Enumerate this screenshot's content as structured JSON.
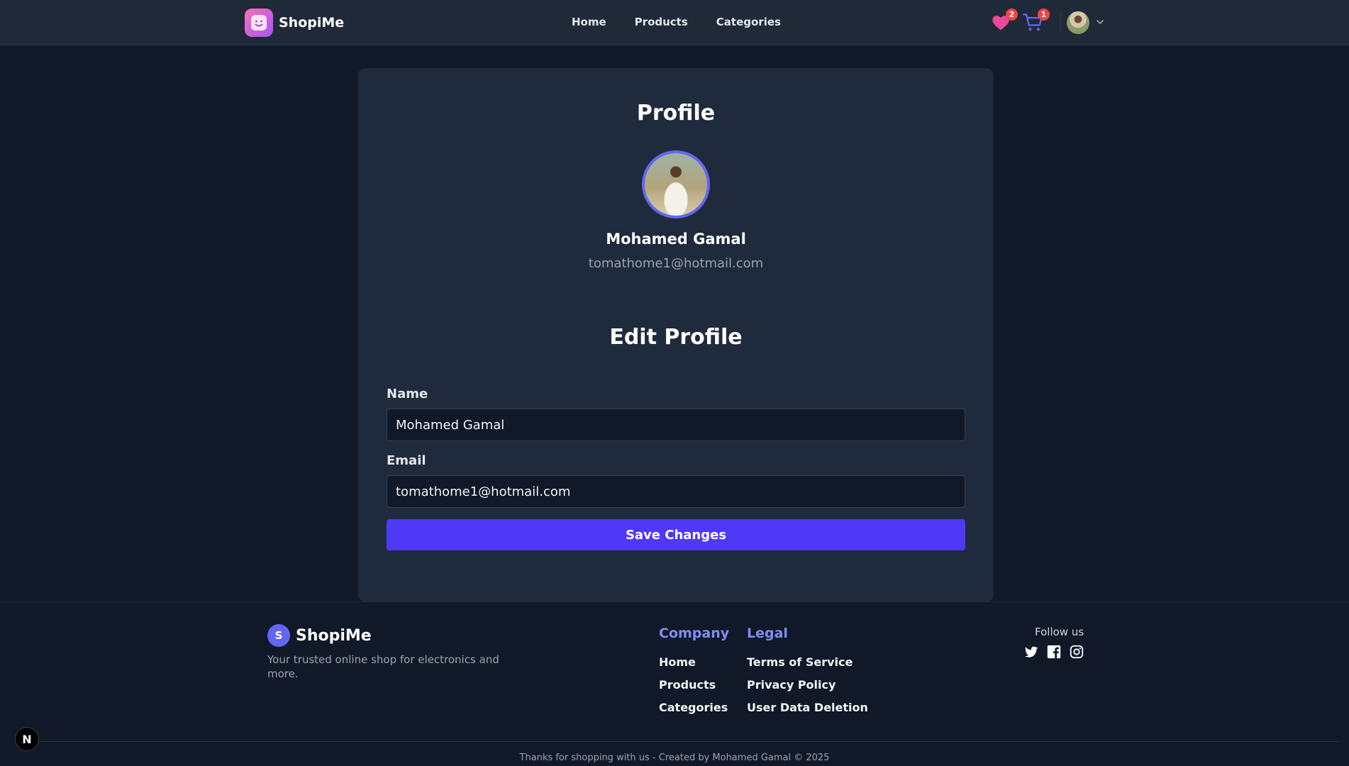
{
  "header": {
    "brand": "ShopiMe",
    "nav": [
      {
        "label": "Home"
      },
      {
        "label": "Products"
      },
      {
        "label": "Categories"
      }
    ],
    "wishlist_count": "2",
    "cart_count": "1",
    "icons": [
      "smile-logo-icon",
      "heart-icon",
      "cart-icon",
      "user-avatar",
      "chevron-down-icon"
    ]
  },
  "profile": {
    "title": "Profile",
    "name": "Mohamed Gamal",
    "email": "tomathome1@hotmail.com"
  },
  "edit": {
    "title": "Edit Profile",
    "name_label": "Name",
    "name_value": "Mohamed Gamal",
    "email_label": "Email",
    "email_value": "tomathome1@hotmail.com",
    "save_label": "Save Changes"
  },
  "footer": {
    "logo_letter": "S",
    "brand": "ShopiMe",
    "tagline": "Your trusted online shop for electronics and more.",
    "company_title": "Company",
    "company_links": [
      {
        "label": "Home"
      },
      {
        "label": "Products"
      },
      {
        "label": "Categories"
      }
    ],
    "legal_title": "Legal",
    "legal_links": [
      {
        "label": "Terms of Service"
      },
      {
        "label": "Privacy Policy"
      },
      {
        "label": "User Data Deletion"
      }
    ],
    "follow_label": "Follow us",
    "social": [
      "twitter-icon",
      "facebook-icon",
      "instagram-icon"
    ],
    "copyright": "Thanks for shopping with us - Created by Mohamed Gamal © 2025"
  },
  "dev_badge": "N",
  "colors": {
    "background": "#111827",
    "header": "#1f2937",
    "card": "#1f2a3c",
    "accent": "#4f39f6",
    "badge": "#ef4444",
    "footer_heading": "#818cf8"
  }
}
